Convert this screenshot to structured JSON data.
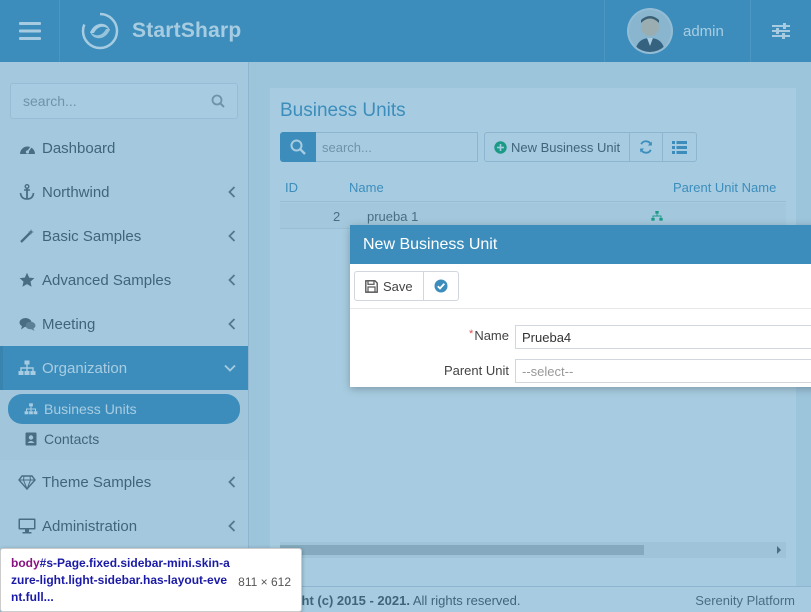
{
  "header": {
    "brand": "StartSharp",
    "username": "admin"
  },
  "sidebar": {
    "search_placeholder": "search...",
    "items": [
      {
        "label": "Dashboard",
        "icon": "dashboard-icon",
        "has_children": false
      },
      {
        "label": "Northwind",
        "icon": "anchor-icon",
        "has_children": true
      },
      {
        "label": "Basic Samples",
        "icon": "magic-wand-icon",
        "has_children": true
      },
      {
        "label": "Advanced Samples",
        "icon": "star-icon",
        "has_children": true
      },
      {
        "label": "Meeting",
        "icon": "comments-icon",
        "has_children": true
      },
      {
        "label": "Organization",
        "icon": "sitemap-icon",
        "has_children": true,
        "expanded": true,
        "active": true
      },
      {
        "label": "Theme Samples",
        "icon": "diamond-icon",
        "has_children": true
      },
      {
        "label": "Administration",
        "icon": "desktop-icon",
        "has_children": true
      }
    ],
    "organization_children": [
      {
        "label": "Business Units",
        "icon": "sitemap-icon",
        "active": true
      },
      {
        "label": "Contacts",
        "icon": "contact-card-icon",
        "active": false
      }
    ]
  },
  "page": {
    "title": "Business Units",
    "search_placeholder": "search...",
    "new_button": "New Business Unit",
    "columns": [
      "ID",
      "Name",
      "Parent Unit Name"
    ],
    "rows": [
      {
        "id": "2",
        "name": "prueba 1",
        "parent": ""
      }
    ]
  },
  "dialog": {
    "title": "New Business Unit",
    "save_label": "Save",
    "name_label": "Name",
    "name_value": "Prueba4",
    "parent_label": "Parent Unit",
    "parent_value": "--select--"
  },
  "footer": {
    "copyright_prefix": "ight (c) 2015 - 2021.",
    "copyright_suffix": " All rights reserved.",
    "platform": "Serenity Platform"
  },
  "devtools_tooltip": {
    "tag": "body",
    "selector": "#s-Page.fixed.sidebar-mini.skin-azure-light.light-sidebar.has-layout-event.full...",
    "size": "811 × 612"
  },
  "colors": {
    "primary": "#3c8dbc",
    "background": "#ecf0f5",
    "overlay": "rgba(60,141,188,0.45)"
  }
}
